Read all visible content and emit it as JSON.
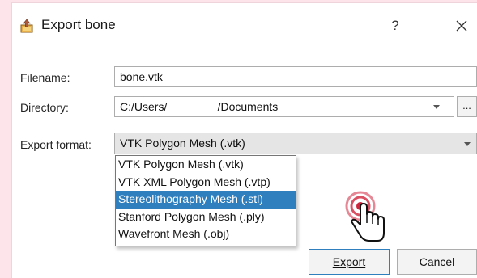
{
  "dialog": {
    "title": "Export bone",
    "help_label": "?",
    "close_icon": "close-icon",
    "title_icon": "export-icon"
  },
  "form": {
    "filename_label": "Filename:",
    "filename_value": "bone.vtk",
    "directory_label": "Directory:",
    "directory_value": "C:/Users/                /Documents",
    "browse_label": "...",
    "format_label": "Export format:",
    "format_value": "VTK Polygon Mesh (.vtk)"
  },
  "format_options": [
    {
      "label": "VTK Polygon Mesh (.vtk)",
      "selected": false
    },
    {
      "label": "VTK XML Polygon Mesh (.vtp)",
      "selected": false
    },
    {
      "label": "Stereolithography Mesh (.stl)",
      "selected": true
    },
    {
      "label": "Stanford Polygon Mesh (.ply)",
      "selected": false
    },
    {
      "label": "Wavefront Mesh (.obj)",
      "selected": false
    }
  ],
  "buttons": {
    "export_label": "Export",
    "cancel_label": "Cancel"
  },
  "colors": {
    "selection": "#2f7fbf",
    "backdrop": "#fce4ea",
    "click_indicator": "#d0243c"
  },
  "cursor_icon": "hand-pointer-icon"
}
